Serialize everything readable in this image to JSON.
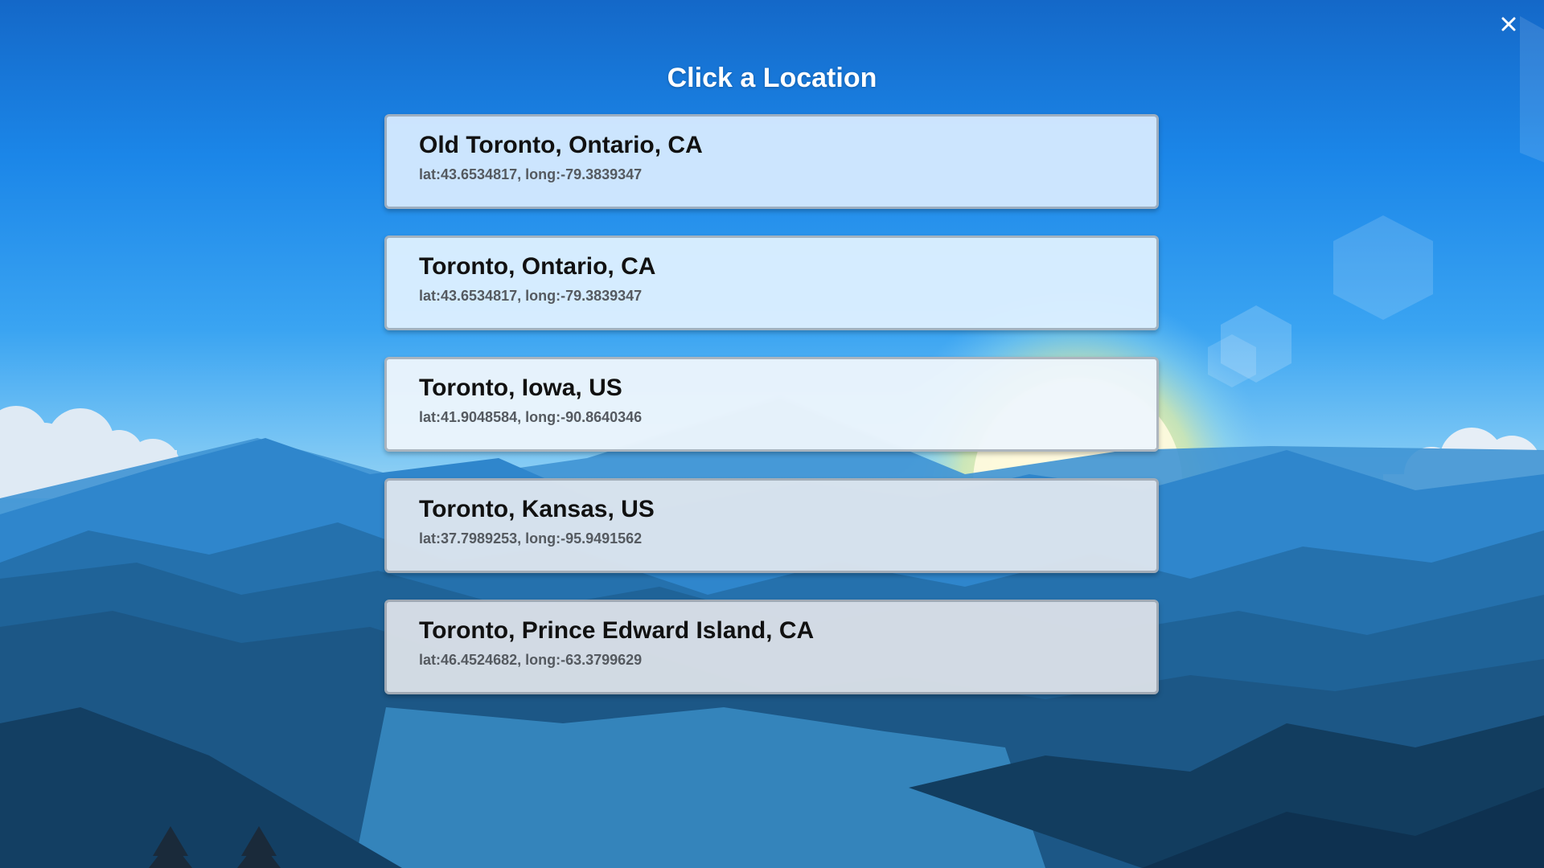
{
  "dialog": {
    "title": "Click a Location",
    "close_icon": "close-icon"
  },
  "locations": [
    {
      "name": "Old Toronto, Ontario, CA",
      "coords": "lat:43.6534817, long:-79.3839347"
    },
    {
      "name": "Toronto, Ontario, CA",
      "coords": "lat:43.6534817, long:-79.3839347"
    },
    {
      "name": "Toronto, Iowa, US",
      "coords": "lat:41.9048584, long:-90.8640346"
    },
    {
      "name": "Toronto, Kansas, US",
      "coords": "lat:37.7989253, long:-95.9491562"
    },
    {
      "name": "Toronto, Prince Edward Island, CA",
      "coords": "lat:46.4524682, long:-63.3799629"
    }
  ],
  "colors": {
    "sky_top": "#1468c8",
    "sky_mid": "#3aa4f2",
    "sun": "#fff6c8",
    "mountain_dark": "#0f3f66",
    "title_text": "#ffffff"
  }
}
